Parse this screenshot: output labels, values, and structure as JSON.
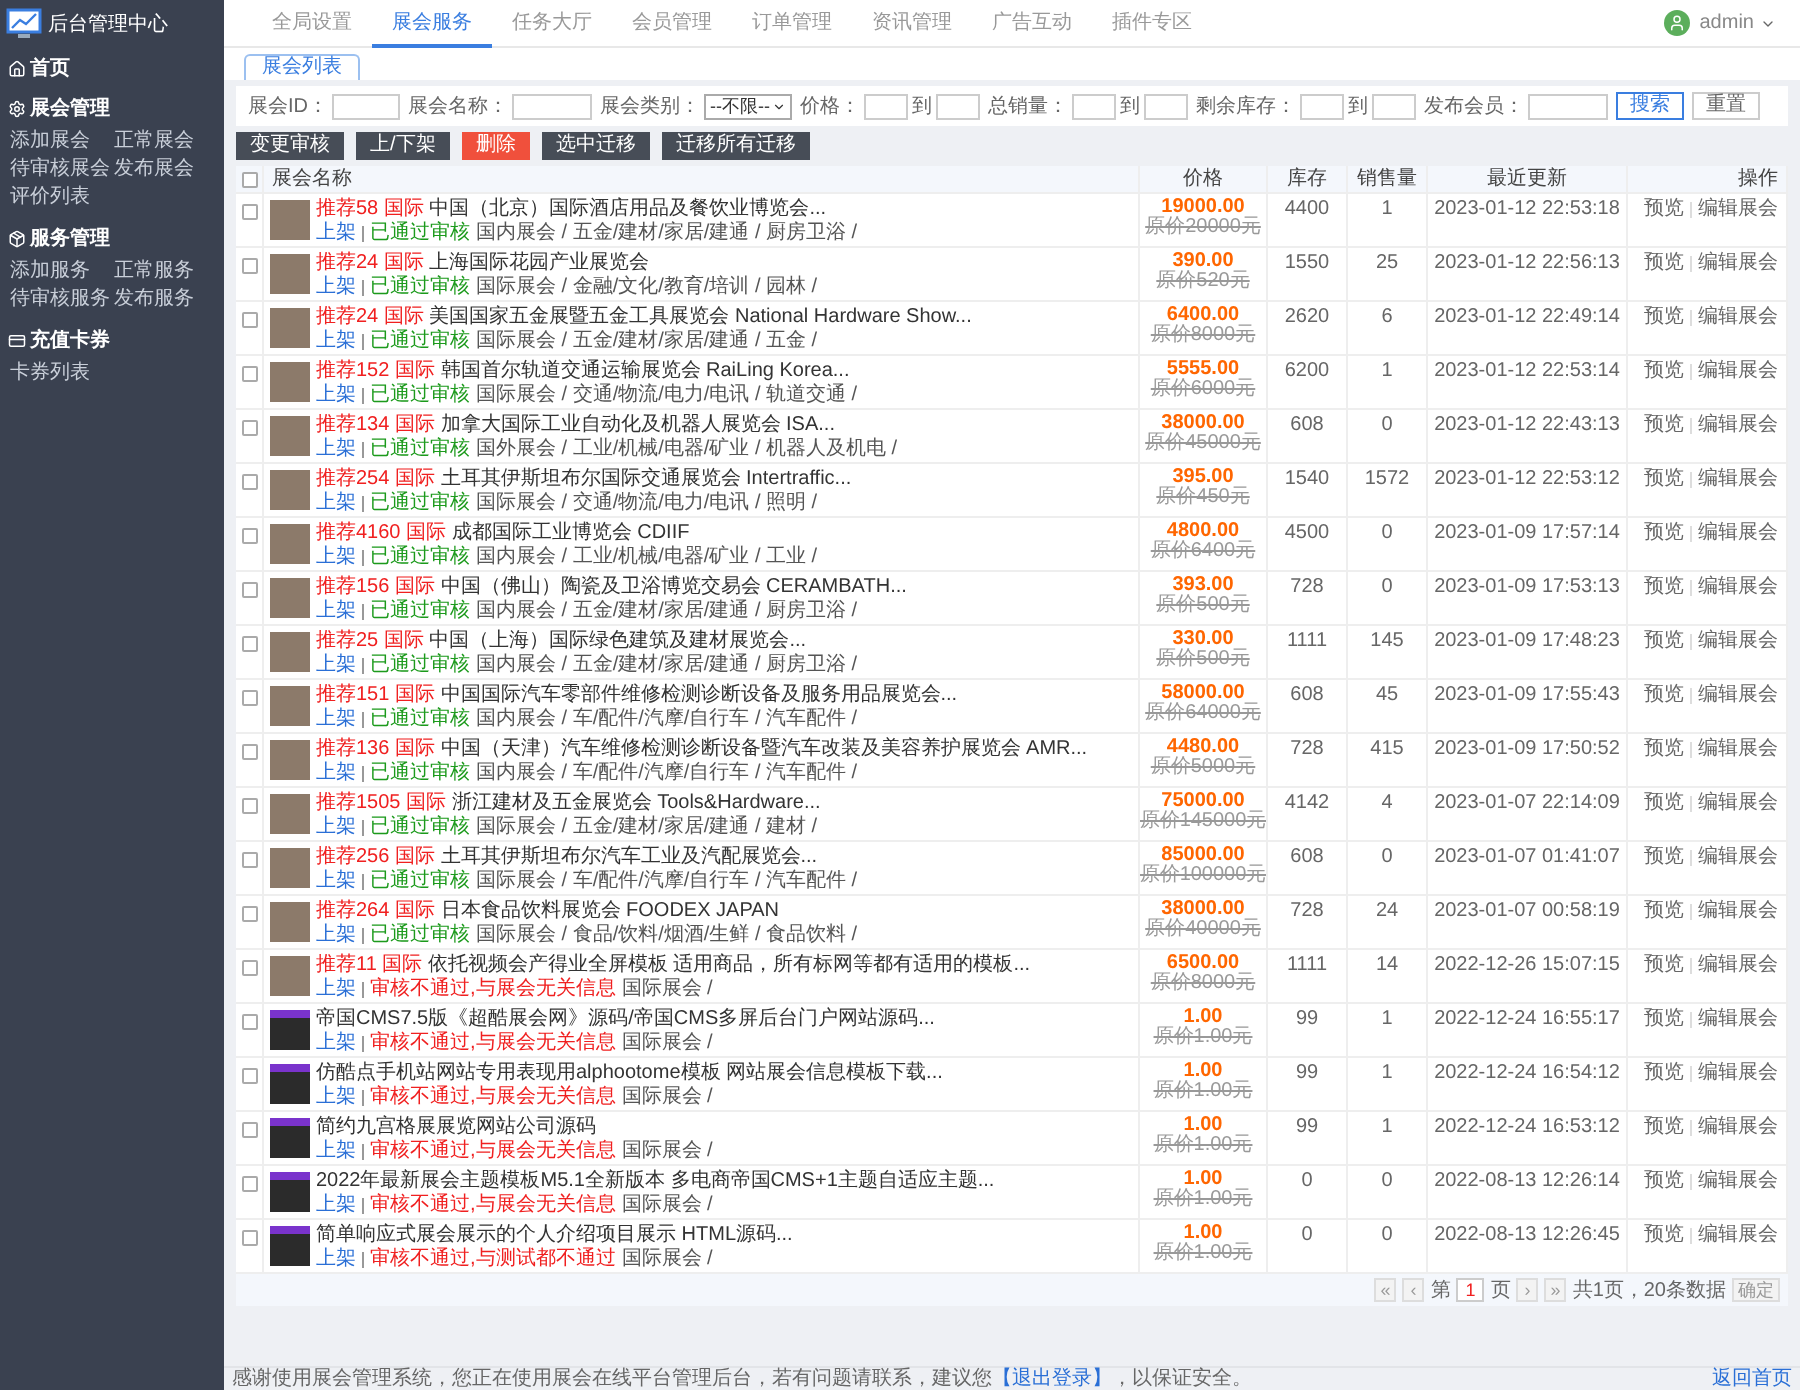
{
  "sidebar": {
    "logo": "后台管理中心",
    "home": "首页",
    "groups": [
      {
        "title": "展会管理",
        "items": [
          "添加展会",
          "正常展会",
          "待审核展会",
          "发布展会",
          "评价列表"
        ]
      },
      {
        "title": "服务管理",
        "items": [
          "添加服务",
          "正常服务",
          "待审核服务",
          "发布服务"
        ]
      },
      {
        "title": "充值卡券",
        "items": [
          "卡券列表"
        ]
      }
    ]
  },
  "top_nav": [
    {
      "label": "全局设置",
      "selected": false
    },
    {
      "label": "展会服务",
      "selected": true
    },
    {
      "label": "任务大厅",
      "selected": false
    },
    {
      "label": "会员管理",
      "selected": false
    },
    {
      "label": "订单管理",
      "selected": false
    },
    {
      "label": "资讯管理",
      "selected": false
    },
    {
      "label": "广告互动",
      "selected": false
    },
    {
      "label": "插件专区",
      "selected": false
    }
  ],
  "user": {
    "name": "admin"
  },
  "tabs": [
    {
      "label": "展会列表",
      "selected": true
    }
  ],
  "filters": [
    {
      "kind": "text",
      "label": "展会ID："
    },
    {
      "kind": "text",
      "label": "展会名称："
    },
    {
      "kind": "select",
      "label": "展会类别：",
      "value": "--不限--"
    },
    {
      "kind": "range",
      "label": "价格：",
      "joiner": "到"
    },
    {
      "kind": "range",
      "label": "总销量：",
      "joiner": "到"
    },
    {
      "kind": "range",
      "label": "剩余库存：",
      "joiner": "到"
    },
    {
      "kind": "text",
      "label": "发布会员："
    }
  ],
  "filter_buttons": [
    {
      "label": "搜索",
      "kind": "primary"
    },
    {
      "label": "重置",
      "kind": "default"
    }
  ],
  "actions": [
    {
      "label": "变更审核",
      "kind": "dark"
    },
    {
      "label": "上/下架",
      "kind": "dark"
    },
    {
      "label": "删除",
      "kind": "danger"
    },
    {
      "label": "选中迁移",
      "kind": "dark"
    },
    {
      "label": "迁移所有迁移",
      "kind": "dark"
    }
  ],
  "table": {
    "select_all": {
      "checked": false
    },
    "columns": [
      "展会名称",
      "价格",
      "库存",
      "销售量",
      "最近更新",
      "操作"
    ],
    "rows": [
      {
        "checked": false,
        "kind": "photo",
        "rec": "推荐58",
        "region": "国际",
        "title": "中国（北京）国际酒店用品及餐饮业博览会...",
        "shelf": "上架",
        "review": "已通过审核",
        "review_ok": true,
        "category": "国内展会 / 五金/建材/家居/建通 / 厨房卫浴 /",
        "price": "19000.00",
        "original": "原价20000元",
        "stock": "4400",
        "sales": "1",
        "updated": "2023-01-12 22:53:18",
        "actions": [
          "预览",
          "编辑展会"
        ]
      },
      {
        "checked": false,
        "kind": "photo",
        "rec": "推荐24",
        "region": "国际",
        "title": "上海国际花园产业展览会",
        "shelf": "上架",
        "review": "已通过审核",
        "review_ok": true,
        "category": "国际展会 / 金融/文化/教育/培训 / 园林 /",
        "price": "390.00",
        "original": "原价520元",
        "stock": "1550",
        "sales": "25",
        "updated": "2023-01-12 22:56:13",
        "actions": [
          "预览",
          "编辑展会"
        ]
      },
      {
        "checked": false,
        "kind": "photo",
        "rec": "推荐24",
        "region": "国际",
        "title": "美国国家五金展暨五金工具展览会 National Hardware Show...",
        "shelf": "上架",
        "review": "已通过审核",
        "review_ok": true,
        "category": "国际展会 / 五金/建材/家居/建通 / 五金 /",
        "price": "6400.00",
        "original": "原价8000元",
        "stock": "2620",
        "sales": "6",
        "updated": "2023-01-12 22:49:14",
        "actions": [
          "预览",
          "编辑展会"
        ]
      },
      {
        "checked": false,
        "kind": "photo",
        "rec": "推荐152",
        "region": "国际",
        "title": "韩国首尔轨道交通运输展览会 RaiLing Korea...",
        "shelf": "上架",
        "review": "已通过审核",
        "review_ok": true,
        "category": "国际展会 / 交通/物流/电力/电讯 / 轨道交通 /",
        "price": "5555.00",
        "original": "原价6000元",
        "stock": "6200",
        "sales": "1",
        "updated": "2023-01-12 22:53:14",
        "actions": [
          "预览",
          "编辑展会"
        ]
      },
      {
        "checked": false,
        "kind": "photo",
        "rec": "推荐134",
        "region": "国际",
        "title": "加拿大国际工业自动化及机器人展览会 ISA...",
        "shelf": "上架",
        "review": "已通过审核",
        "review_ok": true,
        "category": "国外展会 / 工业/机械/电器/矿业 / 机器人及机电 /",
        "price": "38000.00",
        "original": "原价45000元",
        "stock": "608",
        "sales": "0",
        "updated": "2023-01-12 22:43:13",
        "actions": [
          "预览",
          "编辑展会"
        ]
      },
      {
        "checked": false,
        "kind": "photo",
        "rec": "推荐254",
        "region": "国际",
        "title": "土耳其伊斯坦布尔国际交通展览会 Intertraffic...",
        "shelf": "上架",
        "review": "已通过审核",
        "review_ok": true,
        "category": "国际展会 / 交通/物流/电力/电讯 / 照明 /",
        "price": "395.00",
        "original": "原价450元",
        "stock": "1540",
        "sales": "1572",
        "updated": "2023-01-12 22:53:12",
        "actions": [
          "预览",
          "编辑展会"
        ]
      },
      {
        "checked": false,
        "kind": "photo",
        "rec": "推荐4160",
        "region": "国际",
        "title": "成都国际工业博览会 CDIIF",
        "shelf": "上架",
        "review": "已通过审核",
        "review_ok": true,
        "category": "国内展会 / 工业/机械/电器/矿业 / 工业 /",
        "price": "4800.00",
        "original": "原价6400元",
        "stock": "4500",
        "sales": "0",
        "updated": "2023-01-09 17:57:14",
        "actions": [
          "预览",
          "编辑展会"
        ]
      },
      {
        "checked": false,
        "kind": "photo",
        "rec": "推荐156",
        "region": "国际",
        "title": "中国（佛山）陶瓷及卫浴博览交易会 CERAMBATH...",
        "shelf": "上架",
        "review": "已通过审核",
        "review_ok": true,
        "category": "国内展会 / 五金/建材/家居/建通 / 厨房卫浴 /",
        "price": "393.00",
        "original": "原价500元",
        "stock": "728",
        "sales": "0",
        "updated": "2023-01-09 17:53:13",
        "actions": [
          "预览",
          "编辑展会"
        ]
      },
      {
        "checked": false,
        "kind": "photo",
        "rec": "推荐25",
        "region": "国际",
        "title": "中国（上海）国际绿色建筑及建材展览会...",
        "shelf": "上架",
        "review": "已通过审核",
        "review_ok": true,
        "category": "国内展会 / 五金/建材/家居/建通 / 厨房卫浴 /",
        "price": "330.00",
        "original": "原价500元",
        "stock": "1111",
        "sales": "145",
        "updated": "2023-01-09 17:48:23",
        "actions": [
          "预览",
          "编辑展会"
        ]
      },
      {
        "checked": false,
        "kind": "photo",
        "rec": "推荐151",
        "region": "国际",
        "title": "中国国际汽车零部件维修检测诊断设备及服务用品展览会...",
        "shelf": "上架",
        "review": "已通过审核",
        "review_ok": true,
        "category": "国内展会 / 车/配件/汽摩/自行车 / 汽车配件 /",
        "price": "58000.00",
        "original": "原价64000元",
        "stock": "608",
        "sales": "45",
        "updated": "2023-01-09 17:55:43",
        "actions": [
          "预览",
          "编辑展会"
        ]
      },
      {
        "checked": false,
        "kind": "photo",
        "rec": "推荐136",
        "region": "国际",
        "title": "中国（天津）汽车维修检测诊断设备暨汽车改装及美容养护展览会 AMR...",
        "shelf": "上架",
        "review": "已通过审核",
        "review_ok": true,
        "category": "国内展会 / 车/配件/汽摩/自行车 / 汽车配件 /",
        "price": "4480.00",
        "original": "原价5000元",
        "stock": "728",
        "sales": "415",
        "updated": "2023-01-09 17:50:52",
        "actions": [
          "预览",
          "编辑展会"
        ]
      },
      {
        "checked": false,
        "kind": "photo",
        "rec": "推荐1505",
        "region": "国际",
        "title": "浙江建材及五金展览会 Tools&Hardware...",
        "shelf": "上架",
        "review": "已通过审核",
        "review_ok": true,
        "category": "国际展会 / 五金/建材/家居/建通 / 建材 /",
        "price": "75000.00",
        "original": "原价145000元",
        "stock": "4142",
        "sales": "4",
        "updated": "2023-01-07 22:14:09",
        "actions": [
          "预览",
          "编辑展会"
        ]
      },
      {
        "checked": false,
        "kind": "photo",
        "rec": "推荐256",
        "region": "国际",
        "title": "土耳其伊斯坦布尔汽车工业及汽配展览会...",
        "shelf": "上架",
        "review": "已通过审核",
        "review_ok": true,
        "category": "国际展会 / 车/配件/汽摩/自行车 / 汽车配件 /",
        "price": "85000.00",
        "original": "原价100000元",
        "stock": "608",
        "sales": "0",
        "updated": "2023-01-07 01:41:07",
        "actions": [
          "预览",
          "编辑展会"
        ]
      },
      {
        "checked": false,
        "kind": "photo",
        "rec": "推荐264",
        "region": "国际",
        "title": "日本食品饮料展览会 FOODEX JAPAN",
        "shelf": "上架",
        "review": "已通过审核",
        "review_ok": true,
        "category": "国际展会 / 食品/饮料/烟酒/生鲜 / 食品饮料 /",
        "price": "38000.00",
        "original": "原价40000元",
        "stock": "728",
        "sales": "24",
        "updated": "2023-01-07 00:58:19",
        "actions": [
          "预览",
          "编辑展会"
        ]
      },
      {
        "checked": false,
        "kind": "photo",
        "rec": "推荐11",
        "region": "国际",
        "title": "依托视频会产得业全屏模板 适用商品，所有标网等都有适用的模板...",
        "shelf": "上架",
        "review": "审核不通过,与展会无关信息",
        "review_ok": false,
        "category": "国际展会 /",
        "price": "6500.00",
        "original": "原价8000元",
        "stock": "1111",
        "sales": "14",
        "updated": "2022-12-26 15:07:15",
        "actions": [
          "预览",
          "编辑展会"
        ]
      },
      {
        "checked": false,
        "kind": "site",
        "title": "帝国CMS7.5版《超酷展会网》源码/帝国CMS多屏后台门户网站源码...",
        "shelf": "上架",
        "review": "审核不通过,与展会无关信息",
        "review_ok": false,
        "category": "国际展会 /",
        "price": "1.00",
        "original": "原价1.00元",
        "stock": "99",
        "sales": "1",
        "updated": "2022-12-24 16:55:17",
        "actions": [
          "预览",
          "编辑展会"
        ]
      },
      {
        "checked": false,
        "kind": "site",
        "title": "仿酷点手机站网站专用表现用alphootome模板 网站展会信息模板下载...",
        "shelf": "上架",
        "review": "审核不通过,与展会无关信息",
        "review_ok": false,
        "category": "国际展会 /",
        "price": "1.00",
        "original": "原价1.00元",
        "stock": "99",
        "sales": "1",
        "updated": "2022-12-24 16:54:12",
        "actions": [
          "预览",
          "编辑展会"
        ]
      },
      {
        "checked": false,
        "kind": "site",
        "title": "简约九宫格展展览网站公司源码",
        "shelf": "上架",
        "review": "审核不通过,与展会无关信息",
        "review_ok": false,
        "category": "国际展会 /",
        "price": "1.00",
        "original": "原价1.00元",
        "stock": "99",
        "sales": "1",
        "updated": "2022-12-24 16:53:12",
        "actions": [
          "预览",
          "编辑展会"
        ]
      },
      {
        "checked": false,
        "kind": "site",
        "title": "2022年最新展会主题模板M5.1全新版本 多电商帝国CMS+1主题自适应主题...",
        "shelf": "上架",
        "review": "审核不通过,与展会无关信息",
        "review_ok": false,
        "category": "国际展会 /",
        "price": "1.00",
        "original": "原价1.00元",
        "stock": "0",
        "sales": "0",
        "updated": "2022-08-13 12:26:14",
        "actions": [
          "预览",
          "编辑展会"
        ]
      },
      {
        "checked": false,
        "kind": "site",
        "title": "简单响应式展会展示的个人介绍项目展示 HTML源码...",
        "shelf": "上架",
        "review": "审核不通过,与测试都不通过",
        "review_ok": false,
        "category": "国际展会 /",
        "price": "1.00",
        "original": "原价1.00元",
        "stock": "0",
        "sales": "0",
        "updated": "2022-08-13 12:26:45",
        "actions": [
          "预览",
          "编辑展会"
        ]
      }
    ]
  },
  "pagination": {
    "first": "«",
    "prev": "‹",
    "page_prefix": "第",
    "page": "1",
    "page_suffix": "页",
    "next": "›",
    "last": "»",
    "summary": "共1页，20条数据",
    "go": "确定"
  },
  "footer": {
    "before": "感谢使用展会管理系统，您正在使用展会在线平台管理后台，若有问题请联系，建议您",
    "link": "【退出登录】",
    "after": "，以保证安全。",
    "right": "返回首页"
  }
}
